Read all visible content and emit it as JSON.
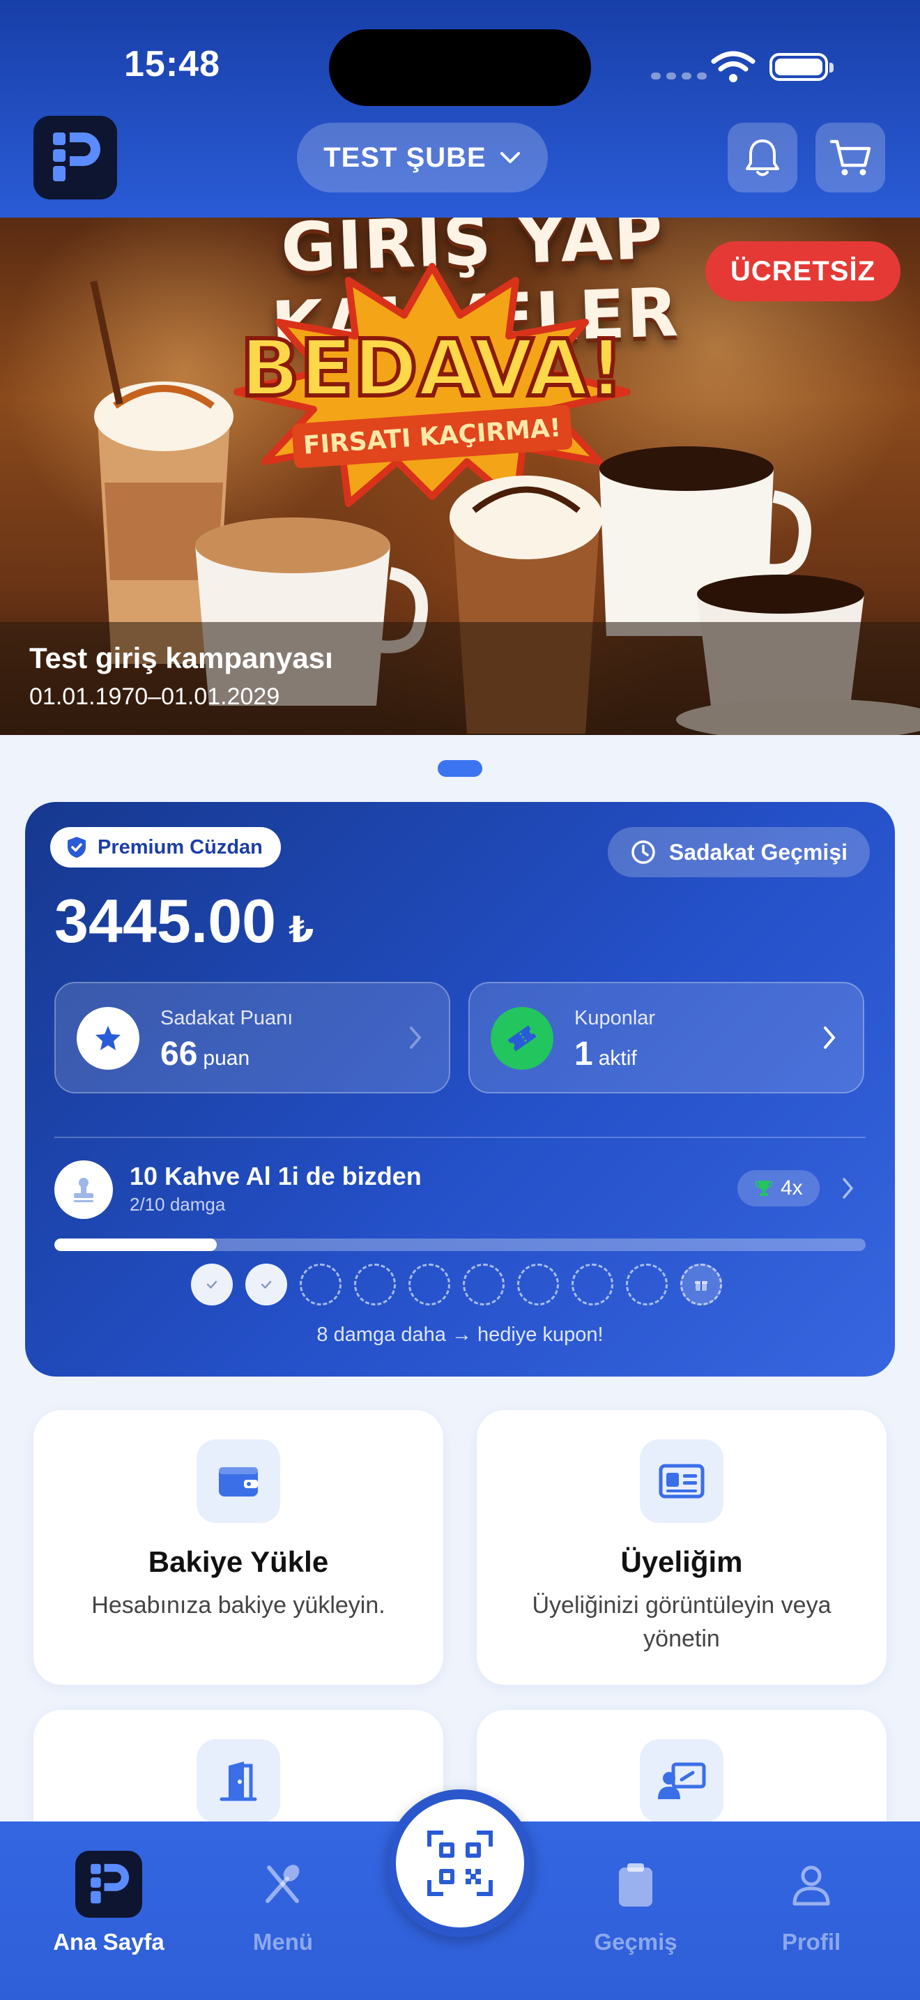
{
  "status_bar": {
    "time": "15:48"
  },
  "header": {
    "branch": "TEST ŞUBE"
  },
  "banner": {
    "headline": "GIRIŞ YAP KAHVELER",
    "burst_title": "BEDAVA!",
    "burst_sub": "FIRSATI KAÇIRMA!",
    "badge": "ÜCRETSİZ",
    "title": "Test giriş kampanyası",
    "date": "01.01.1970–01.01.2029",
    "page_index": 1,
    "page_count": 1
  },
  "wallet": {
    "tier": "Premium Cüzdan",
    "history_label": "Sadakat Geçmişi",
    "balance": "3445.00",
    "currency": "₺",
    "points_label": "Sadakat Puanı",
    "points_value": "66",
    "points_unit": "puan",
    "coupons_label": "Kuponlar",
    "coupons_value": "1",
    "coupons_unit": "aktif",
    "stamp_title": "10 Kahve Al 1i de bizden",
    "stamp_sub": "2/10 damga",
    "multiplier": "4x",
    "stamps_collected": 2,
    "stamps_total": 10,
    "stamp_note": "8 damga daha → hediye kupon!"
  },
  "actions": [
    {
      "title": "Bakiye Yükle",
      "desc": "Hesabınıza bakiye yükleyin.",
      "icon": "wallet-icon"
    },
    {
      "title": "Üyeliğim",
      "desc": "Üyeliğinizi görüntüleyin veya yönetin",
      "icon": "id-card-icon"
    },
    {
      "icon": "door-exit-icon"
    },
    {
      "icon": "user-screen-icon"
    }
  ],
  "tabbar": {
    "home": "Ana Sayfa",
    "menu": "Menü",
    "history": "Geçmiş",
    "profile": "Profil"
  },
  "colors": {
    "primary": "#2a5bd6",
    "danger": "#e53935",
    "success": "#22c55e",
    "background": "#eef3fc"
  }
}
